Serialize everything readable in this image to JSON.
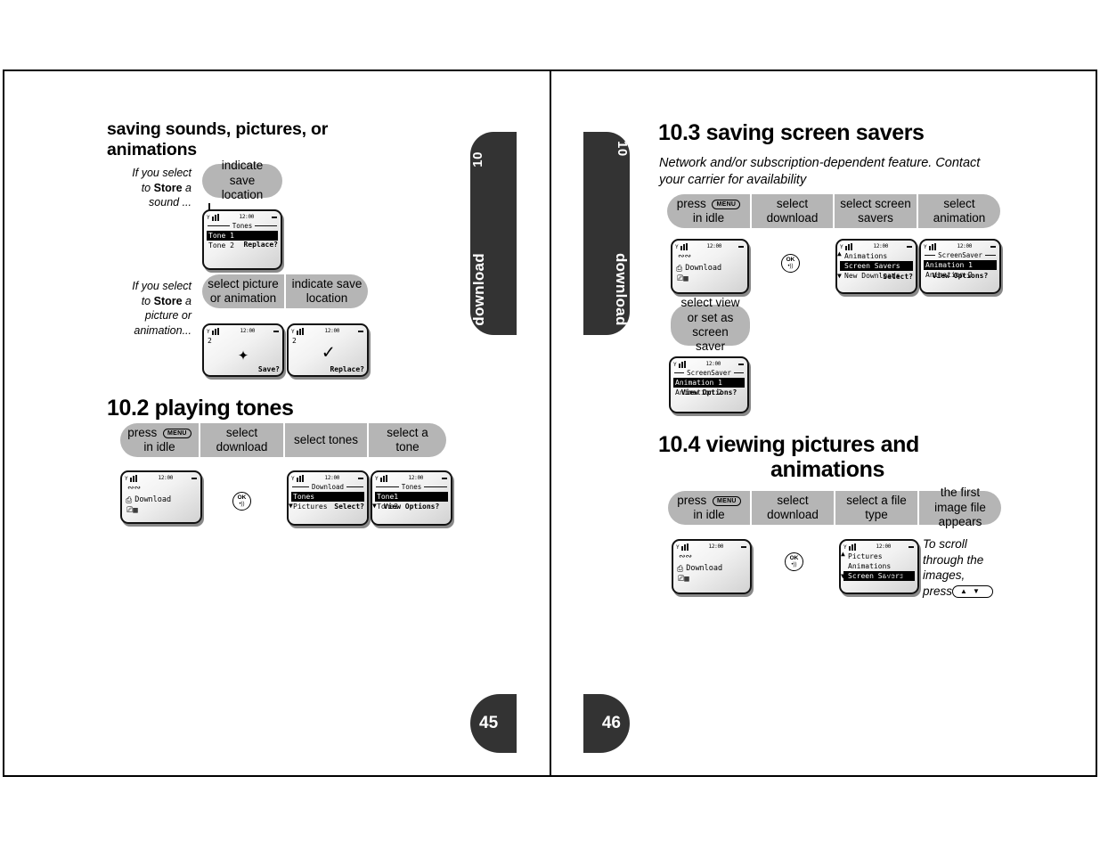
{
  "book": {
    "tab_chapter": "10",
    "tab_word": "download",
    "page_left": "45",
    "page_right": "46"
  },
  "left_page": {
    "heading": "saving sounds, pictures, or animations",
    "sound_note": {
      "line1": "If you select",
      "line2_pre": "to ",
      "line2_bold": "Store",
      "line2_post": " a",
      "line3": "sound ..."
    },
    "sound_pills": [
      {
        "label": "indicate save location"
      }
    ],
    "tones_screen": {
      "clock": "12:00",
      "title": "Tones",
      "items": [
        "Tone 1",
        "Tone 2"
      ],
      "selected_index": 0,
      "softkey": "Replace?"
    },
    "picture_note": {
      "line1": "If you select",
      "line2_pre": "to ",
      "line2_bold": "Store",
      "line2_post": " a",
      "line3": "picture or",
      "line4": "animation..."
    },
    "picture_pills": [
      {
        "label": "select picture or animation"
      },
      {
        "label": "indicate save location"
      }
    ],
    "save_screen": {
      "clock": "12:00",
      "corner_num": "2",
      "icon": "sparkle-icon",
      "softkey": "Save?"
    },
    "replace_screen": {
      "clock": "12:00",
      "corner_num": "2",
      "icon": "check-icon",
      "softkey": "Replace?"
    },
    "section_10_2": {
      "heading": "10.2 playing tones",
      "pills": [
        {
          "pre": "press ",
          "key": "MENU",
          "post": "in idle"
        },
        {
          "label": "select download"
        },
        {
          "label": "select tones"
        },
        {
          "label": "select a tone"
        }
      ],
      "idle_screen": {
        "clock": "12:00",
        "label": "Download",
        "icons": [
          "link-icon",
          "printer-icon",
          "phone-card-icon"
        ]
      },
      "ok_key": {
        "top": "OK",
        "bottom": "•))"
      },
      "download_screen": {
        "clock": "12:00",
        "title": "Download",
        "items": [
          "Tones",
          "Pictures"
        ],
        "selected_index": 0,
        "softkey": "Select?"
      },
      "tones_screen": {
        "clock": "12:00",
        "title": "Tones",
        "items": [
          "Tone1",
          "Tone2"
        ],
        "selected_index": 0,
        "softkey": "View Options?"
      }
    }
  },
  "right_page": {
    "section_10_3": {
      "heading": "10.3 saving screen savers",
      "note": "Network and/or subscription-dependent feature. Contact your carrier for availability",
      "pills": [
        {
          "pre": "press ",
          "key": "MENU",
          "post": "in idle"
        },
        {
          "label": "select download"
        },
        {
          "label": "select screen savers"
        },
        {
          "label": "select animation"
        }
      ],
      "idle_screen": {
        "clock": "12:00",
        "label": "Download",
        "icons": [
          "link-icon",
          "printer-icon",
          "phone-card-icon"
        ]
      },
      "ok_key": {
        "top": "OK",
        "bottom": "•))"
      },
      "list_screen": {
        "clock": "12:00",
        "items": [
          "Animations",
          "Screen Savers",
          "New Downloads"
        ],
        "selected_index": 1,
        "softkey": "Select?"
      },
      "screensaver_screen": {
        "clock": "12:00",
        "title": "ScreenSaver",
        "items": [
          "Animation 1",
          "Animation 2"
        ],
        "selected_index": 0,
        "softkey": "View Options?"
      },
      "second_pill": {
        "label": "select view or set as screen saver"
      },
      "screensaver_screen2": {
        "clock": "12:00",
        "title": "ScreenSaver",
        "items": [
          "Animation 1",
          "Animation 2"
        ],
        "selected_index": 0,
        "softkey": "View Options?"
      }
    },
    "section_10_4": {
      "heading_line1": "10.4 viewing pictures and",
      "heading_line2": "animations",
      "pills": [
        {
          "pre": "press ",
          "key": "MENU",
          "post": "in idle"
        },
        {
          "label": "select download"
        },
        {
          "label": "select a file type"
        },
        {
          "label": "the first image file appears"
        }
      ],
      "idle_screen": {
        "clock": "12:00",
        "label": "Download",
        "icons": [
          "link-icon",
          "printer-icon",
          "phone-card-icon"
        ]
      },
      "ok_key": {
        "top": "OK",
        "bottom": "•))"
      },
      "filetype_screen": {
        "clock": "12:00",
        "items": [
          "Pictures",
          "Animations",
          "Screen Savers"
        ],
        "selected_index": 2,
        "softkey": "Select?"
      },
      "scroll_note": {
        "line1": "To scroll",
        "line2": "through the",
        "line3": "images,",
        "line4": "press",
        "key_up": "▲",
        "key_down": "▼"
      }
    }
  }
}
